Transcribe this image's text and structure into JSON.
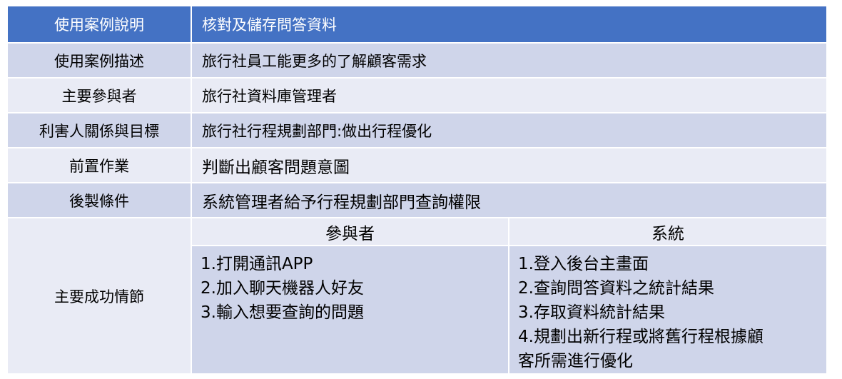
{
  "header": {
    "label": "使用案例說明",
    "value": "核對及儲存問答資料"
  },
  "rows": [
    {
      "label": "使用案例描述",
      "value": "旅行社員工能更多的了解顧客需求"
    },
    {
      "label": "主要參與者",
      "value": "旅行社資料庫管理者"
    },
    {
      "label": "利害人關係與目標",
      "value": "旅行社行程規劃部門:做出行程優化"
    },
    {
      "label": "前置作業",
      "value": "判斷出顧客問題意圖"
    },
    {
      "label": "後製條件",
      "value": "系統管理者給予行程規劃部門查詢權限"
    }
  ],
  "main_flow": {
    "label": "主要成功情節",
    "participant_header": "參與者",
    "system_header": "系統",
    "participant_steps": [
      "1.打開通訊APP",
      "2.加入聊天機器人好友",
      "3.輸入想要查詢的問題"
    ],
    "system_steps": [
      "1.登入後台主畫面",
      "2.查詢問答資料之統計結果",
      "3.存取資料統計結果",
      "4.規劃出新行程或將舊行程根據顧",
      "客所需進行優化"
    ]
  }
}
